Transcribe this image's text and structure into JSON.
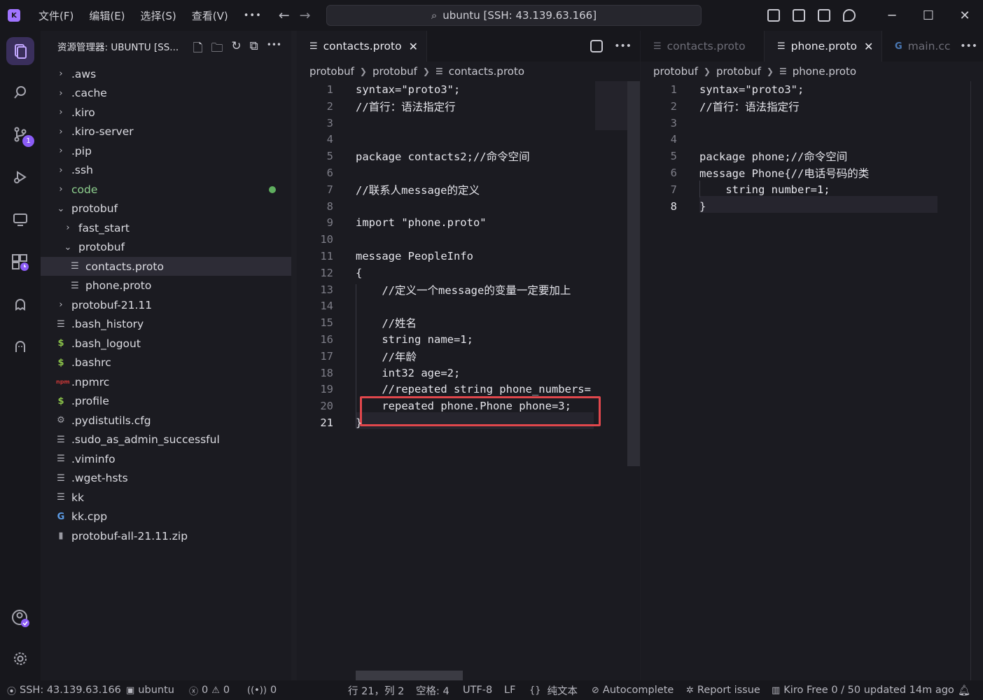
{
  "titlebar": {
    "menus": [
      "文件(F)",
      "编辑(E)",
      "选择(S)",
      "查看(V)"
    ],
    "more": "•••",
    "search_text": "ubuntu [SSH: 43.139.63.166]"
  },
  "activity": {
    "scm_badge": "1"
  },
  "sidebar": {
    "title": "资源管理器: UBUNTU [SS...",
    "items": [
      {
        "label": ".aws",
        "kind": "folder-collapsed"
      },
      {
        "label": ".cache",
        "kind": "folder-collapsed"
      },
      {
        "label": ".kiro",
        "kind": "folder-collapsed"
      },
      {
        "label": ".kiro-server",
        "kind": "folder-collapsed"
      },
      {
        "label": ".pip",
        "kind": "folder-collapsed"
      },
      {
        "label": ".ssh",
        "kind": "folder-collapsed"
      },
      {
        "label": "code",
        "kind": "folder-collapsed"
      },
      {
        "label": "protobuf",
        "kind": "folder-expanded"
      },
      {
        "label": "fast_start",
        "kind": "folder-collapsed"
      },
      {
        "label": "protobuf",
        "kind": "folder-expanded"
      },
      {
        "label": "contacts.proto",
        "kind": "file"
      },
      {
        "label": "phone.proto",
        "kind": "file"
      },
      {
        "label": "protobuf-21.11",
        "kind": "folder-collapsed"
      },
      {
        "label": ".bash_history",
        "kind": "file"
      },
      {
        "label": ".bash_logout",
        "kind": "shell"
      },
      {
        "label": ".bashrc",
        "kind": "shell"
      },
      {
        "label": ".npmrc",
        "kind": "npm"
      },
      {
        "label": ".profile",
        "kind": "shell"
      },
      {
        "label": ".pydistutils.cfg",
        "kind": "gear"
      },
      {
        "label": ".sudo_as_admin_successful",
        "kind": "file"
      },
      {
        "label": ".viminfo",
        "kind": "file"
      },
      {
        "label": ".wget-hsts",
        "kind": "file"
      },
      {
        "label": "kk",
        "kind": "file"
      },
      {
        "label": "kk.cpp",
        "kind": "cpp"
      },
      {
        "label": "protobuf-all-21.11.zip",
        "kind": "zip"
      }
    ]
  },
  "editor1": {
    "tab_label": "contacts.proto",
    "breadcrumb": [
      "protobuf",
      "protobuf",
      "contacts.proto"
    ],
    "lines": [
      "syntax=\"proto3\";",
      "//首行：语法指定行",
      "",
      "",
      "package contacts2;//命令空间",
      "",
      "//联系人message的定义",
      "",
      "import \"phone.proto\"",
      "",
      "message PeopleInfo",
      "{",
      "    //定义一个message的变量一定要加上",
      "",
      "    //姓名",
      "    string name=1;",
      "    //年龄",
      "    int32 age=2;",
      "    //repeated string phone_numbers=",
      "    repeated phone.Phone phone=3;",
      "}"
    ],
    "line_numbers": [
      "1",
      "2",
      "3",
      "4",
      "5",
      "6",
      "7",
      "8",
      "9",
      "10",
      "11",
      "12",
      "13",
      "14",
      "15",
      "16",
      "17",
      "18",
      "19",
      "20",
      "21"
    ]
  },
  "editor2": {
    "tabs": [
      "contacts.proto",
      "phone.proto",
      "main.cc"
    ],
    "active_tab": "phone.proto",
    "breadcrumb": [
      "protobuf",
      "protobuf",
      "phone.proto"
    ],
    "lines": [
      "syntax=\"proto3\";",
      "//首行：语法指定行",
      "",
      "",
      "package phone;//命令空间",
      "message Phone{//电话号码的类",
      "    string number=1;",
      "}"
    ],
    "line_numbers": [
      "1",
      "2",
      "3",
      "4",
      "5",
      "6",
      "7",
      "8"
    ]
  },
  "statusbar": {
    "ssh": "SSH: 43.139.63.166",
    "workspace": "ubuntu",
    "errors": "0",
    "warnings": "0",
    "ports": "0",
    "position": "行 21，列 2",
    "spaces": "空格: 4",
    "encoding": "UTF-8",
    "eol": "LF",
    "language": "纯文本",
    "autocomplete": "Autocomplete",
    "report": "Report issue",
    "kiro": "Kiro Free 0 / 50 updated 14m ago"
  }
}
